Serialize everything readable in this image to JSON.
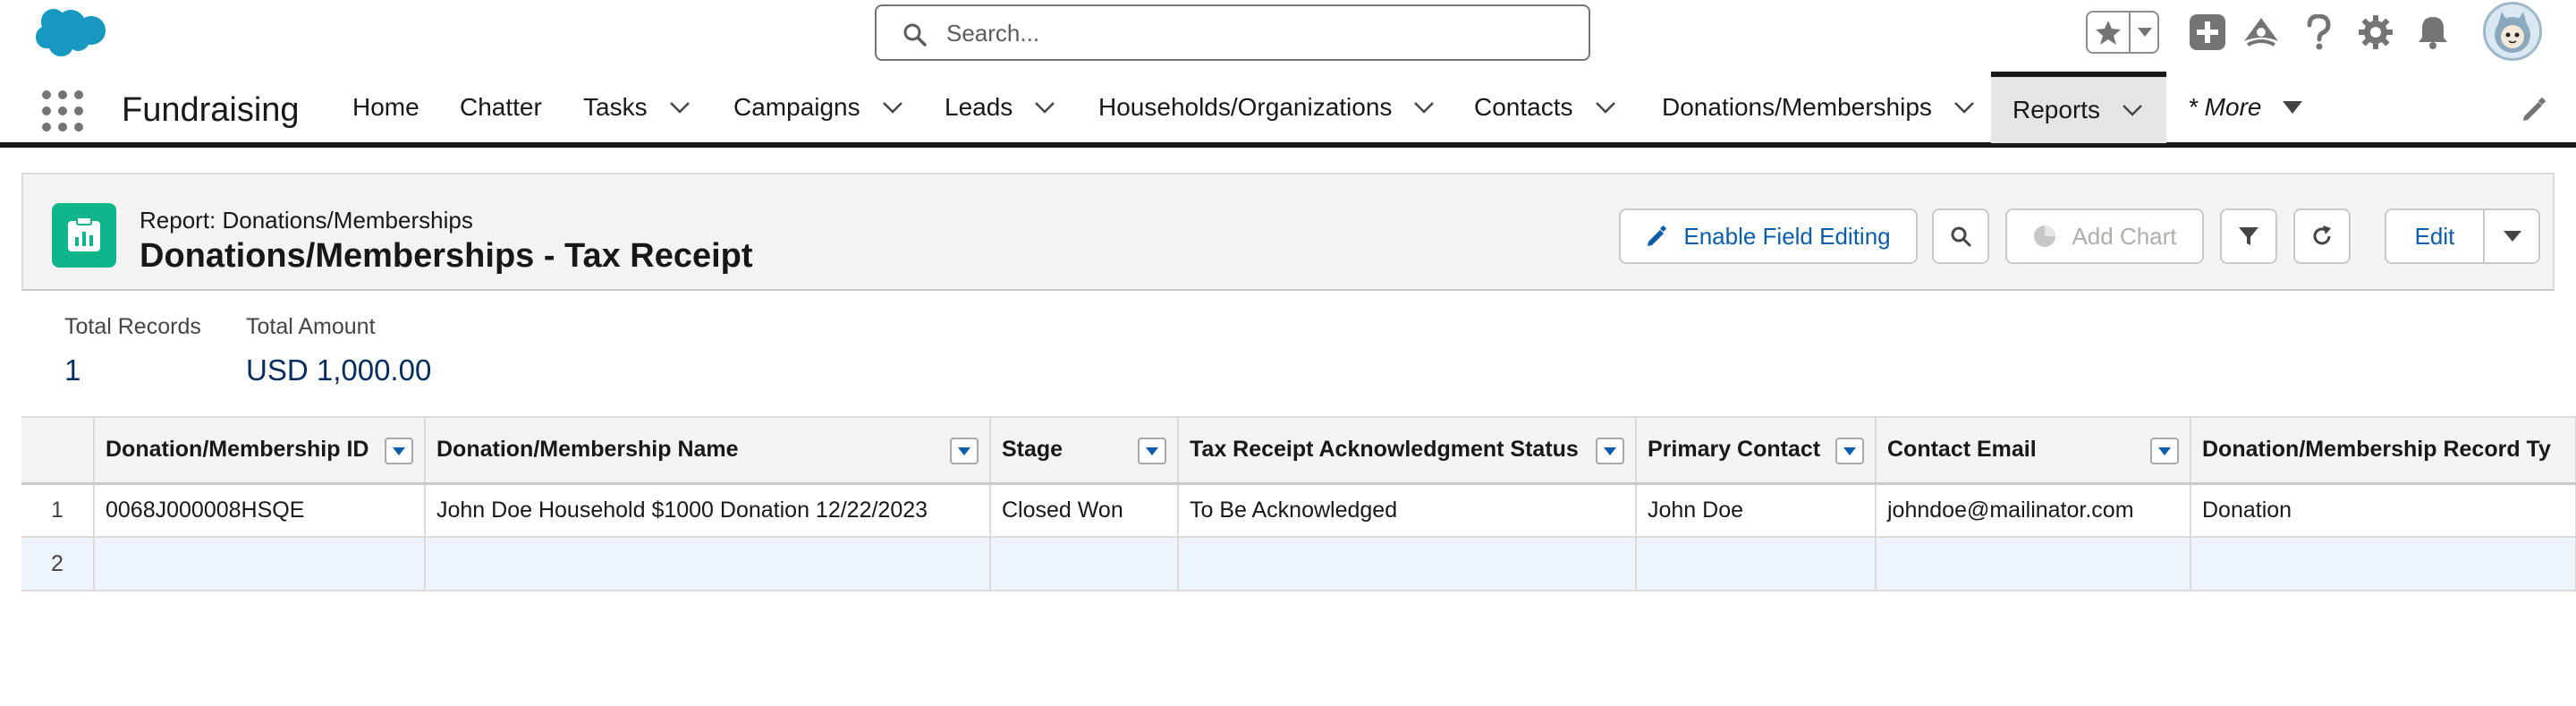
{
  "global_header": {
    "search_placeholder": "Search..."
  },
  "app_nav": {
    "app_name": "Fundraising",
    "items": [
      {
        "label": "Home"
      },
      {
        "label": "Chatter"
      },
      {
        "label": "Tasks"
      },
      {
        "label": "Campaigns"
      },
      {
        "label": "Leads"
      },
      {
        "label": "Households/Organizations"
      },
      {
        "label": "Contacts"
      },
      {
        "label": "Donations/Memberships"
      },
      {
        "label": "Reports"
      },
      {
        "label": "* More"
      }
    ]
  },
  "report_header": {
    "eyebrow": "Report: Donations/Memberships",
    "title": "Donations/Memberships - Tax Receipt",
    "buttons": {
      "enable_field_editing": "Enable Field Editing",
      "add_chart": "Add Chart",
      "edit": "Edit"
    }
  },
  "summary": {
    "total_records_label": "Total Records",
    "total_records_value": "1",
    "total_amount_label": "Total Amount",
    "total_amount_value": "USD 1,000.00"
  },
  "table": {
    "columns": [
      "Donation/Membership ID",
      "Donation/Membership Name",
      "Stage",
      "Tax Receipt Acknowledgment Status",
      "Primary Contact",
      "Contact Email",
      "Donation/Membership Record Ty"
    ],
    "rows": [
      {
        "num": "1",
        "id": "0068J000008HSQE",
        "name": "John Doe Household $1000 Donation 12/22/2023",
        "stage": "Closed Won",
        "ack_status": "To Be Acknowledged",
        "primary_contact": "John Doe",
        "email": "johndoe@mailinator.com",
        "record_type": "Donation"
      },
      {
        "num": "2",
        "id": "",
        "name": "",
        "stage": "",
        "ack_status": "",
        "primary_contact": "",
        "email": "",
        "record_type": ""
      }
    ]
  },
  "colors": {
    "brand_blue": "#0b5cab",
    "report_icon_green": "#0eb58a",
    "value_navy": "#032d60"
  }
}
